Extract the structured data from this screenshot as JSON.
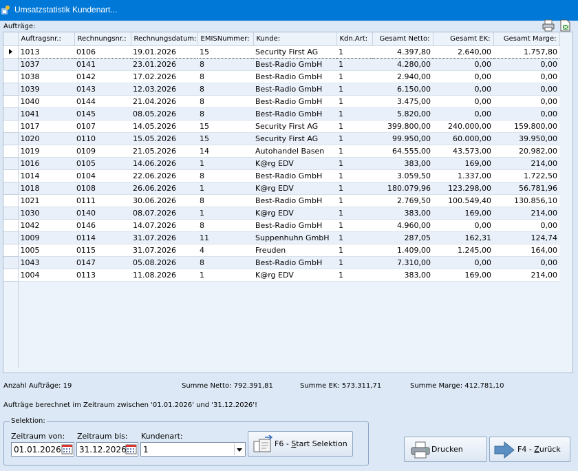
{
  "window": {
    "title": "Umsatzstatistik Kundenart..."
  },
  "orders_label": "Aufträge:",
  "table": {
    "columns": [
      "Auftragsnr.:",
      "Rechnungsnr.:",
      "Rechnungsdatum:",
      "EMISNummer:",
      "Kunde:",
      "Kdn.Art:",
      "Gesamt Netto:",
      "Gesamt EK:",
      "Gesamt Marge:"
    ],
    "rows": [
      [
        "1013",
        "0106",
        "19.01.2026",
        "15",
        "Security First AG",
        "1",
        "4.397,80",
        "2.640,00",
        "1.757,80"
      ],
      [
        "1037",
        "0141",
        "23.01.2026",
        "8",
        "Best-Radio GmbH",
        "1",
        "4.280,00",
        "0,00",
        "0,00"
      ],
      [
        "1038",
        "0142",
        "17.02.2026",
        "8",
        "Best-Radio GmbH",
        "1",
        "2.940,00",
        "0,00",
        "0,00"
      ],
      [
        "1039",
        "0143",
        "12.03.2026",
        "8",
        "Best-Radio GmbH",
        "1",
        "6.150,00",
        "0,00",
        "0,00"
      ],
      [
        "1040",
        "0144",
        "21.04.2026",
        "8",
        "Best-Radio GmbH",
        "1",
        "3.475,00",
        "0,00",
        "0,00"
      ],
      [
        "1041",
        "0145",
        "08.05.2026",
        "8",
        "Best-Radio GmbH",
        "1",
        "5.820,00",
        "0,00",
        "0,00"
      ],
      [
        "1017",
        "0107",
        "14.05.2026",
        "15",
        "Security First AG",
        "1",
        "399.800,00",
        "240.000,00",
        "159.800,00"
      ],
      [
        "1020",
        "0110",
        "15.05.2026",
        "15",
        "Security First AG",
        "1",
        "99.950,00",
        "60.000,00",
        "39.950,00"
      ],
      [
        "1019",
        "0109",
        "21.05.2026",
        "14",
        "Autohandel Basen",
        "1",
        "64.555,00",
        "43.573,00",
        "20.982,00"
      ],
      [
        "1016",
        "0105",
        "14.06.2026",
        "1",
        "K@rg EDV",
        "1",
        "383,00",
        "169,00",
        "214,00"
      ],
      [
        "1014",
        "0104",
        "22.06.2026",
        "8",
        "Best-Radio GmbH",
        "1",
        "3.059,50",
        "1.337,00",
        "1.722,50"
      ],
      [
        "1018",
        "0108",
        "26.06.2026",
        "1",
        "K@rg EDV",
        "1",
        "180.079,96",
        "123.298,00",
        "56.781,96"
      ],
      [
        "1021",
        "0111",
        "30.06.2026",
        "8",
        "Best-Radio GmbH",
        "1",
        "2.769,50",
        "100.549,40",
        "130.856,10"
      ],
      [
        "1030",
        "0140",
        "08.07.2026",
        "1",
        "K@rg EDV",
        "1",
        "383,00",
        "169,00",
        "214,00"
      ],
      [
        "1042",
        "0146",
        "14.07.2026",
        "8",
        "Best-Radio GmbH",
        "1",
        "4.960,00",
        "0,00",
        "0,00"
      ],
      [
        "1009",
        "0114",
        "31.07.2026",
        "11",
        "Suppenhuhn GmbH",
        "1",
        "287,05",
        "162,31",
        "124,74"
      ],
      [
        "1005",
        "0115",
        "31.07.2026",
        "4",
        "Freuden",
        "1",
        "1.409,00",
        "1.245,00",
        "164,00"
      ],
      [
        "1043",
        "0147",
        "05.08.2026",
        "8",
        "Best-Radio GmbH",
        "1",
        "7.310,00",
        "0,00",
        "0,00"
      ],
      [
        "1004",
        "0113",
        "11.08.2026",
        "1",
        "K@rg EDV",
        "1",
        "383,00",
        "169,00",
        "214,00"
      ]
    ],
    "selected_row": 0
  },
  "summary": {
    "count": "Anzahl Aufträge: 19",
    "netto": "Summe Netto: 792.391,81",
    "ek": "Summe EK: 573.311,71",
    "marge": "Summe Marge: 412.781,10"
  },
  "range_text": "Aufträge berechnet im Zeitraum zwischen '01.01.2026' und '31.12.2026'!",
  "selection": {
    "legend": "Selektion:",
    "from_label": "Zeitraum von:",
    "from_value": "01.01.2026",
    "to_label": "Zeitraum bis:",
    "to_value": "31.12.2026",
    "type_label": "Kundenart:",
    "type_value": "1",
    "start_prefix": "F6 - ",
    "start_hotkey": "S",
    "start_rest": "tart Selektion"
  },
  "buttons": {
    "print": "Drucken",
    "back_prefix": "F4 - ",
    "back_hotkey": "Z",
    "back_rest": "urück"
  },
  "colors": {
    "titlebar": "#0078d7",
    "background": "#dce8f5",
    "row_alt": "#e9f0f9",
    "arrow": "#5b8fc4"
  }
}
